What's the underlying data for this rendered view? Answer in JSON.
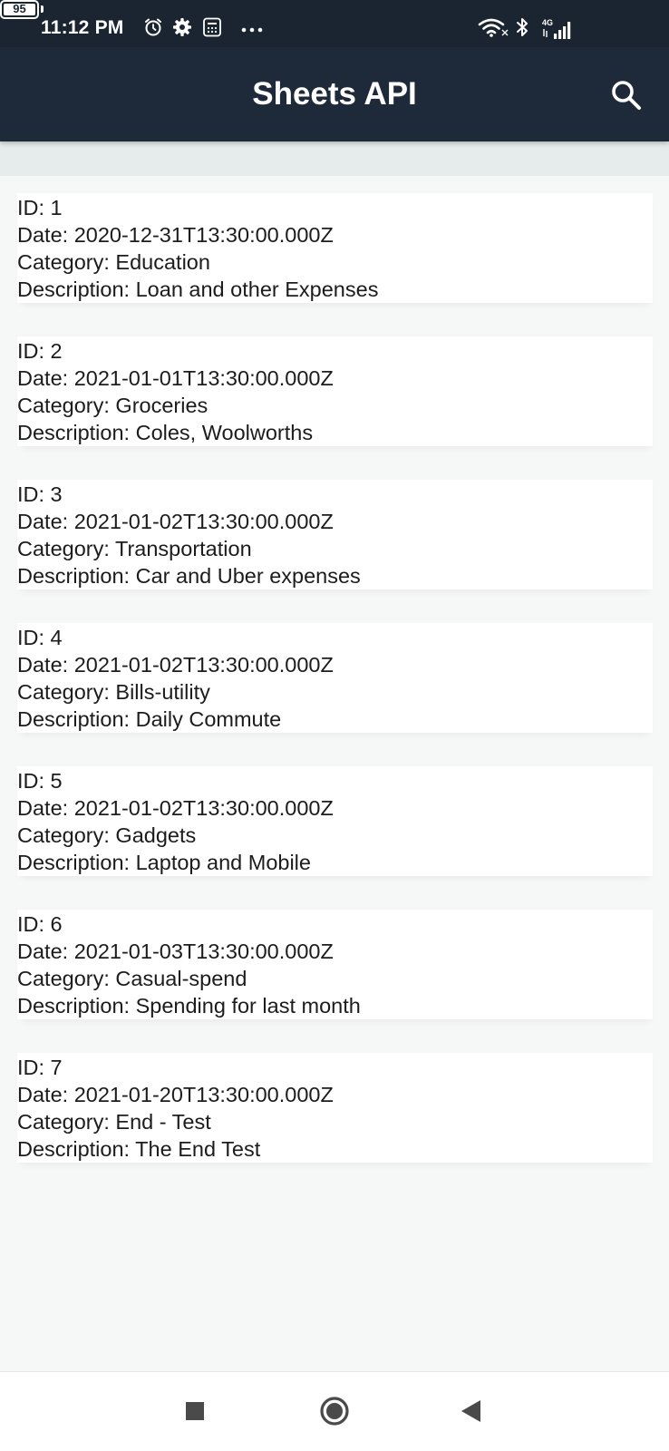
{
  "status_bar": {
    "time": "11:12 PM",
    "network": "4G",
    "battery": "95"
  },
  "app_bar": {
    "title": "Sheets API",
    "search_icon": "search-icon"
  },
  "records": [
    {
      "id": "ID: 1",
      "date": "Date: 2020-12-31T13:30:00.000Z",
      "category": "Category: Education",
      "description": "Description: Loan and other Expenses"
    },
    {
      "id": "ID: 2",
      "date": "Date: 2021-01-01T13:30:00.000Z",
      "category": "Category: Groceries",
      "description": "Description: Coles, Woolworths"
    },
    {
      "id": "ID: 3",
      "date": "Date: 2021-01-02T13:30:00.000Z",
      "category": "Category: Transportation",
      "description": "Description: Car and Uber expenses"
    },
    {
      "id": "ID: 4",
      "date": "Date: 2021-01-02T13:30:00.000Z",
      "category": "Category: Bills-utility",
      "description": "Description: Daily Commute"
    },
    {
      "id": "ID: 5",
      "date": "Date: 2021-01-02T13:30:00.000Z",
      "category": "Category: Gadgets",
      "description": "Description: Laptop and Mobile"
    },
    {
      "id": "ID: 6",
      "date": "Date: 2021-01-03T13:30:00.000Z",
      "category": "Category: Casual-spend",
      "description": "Description: Spending for last month"
    },
    {
      "id": "ID: 7",
      "date": "Date: 2021-01-20T13:30:00.000Z",
      "category": "Category: End - Test",
      "description": "Description: The End Test"
    }
  ],
  "colors": {
    "app_bar": "#1e2a3a",
    "status_bar": "#1b2532",
    "background": "#f6f7f7",
    "card": "#ffffff"
  }
}
